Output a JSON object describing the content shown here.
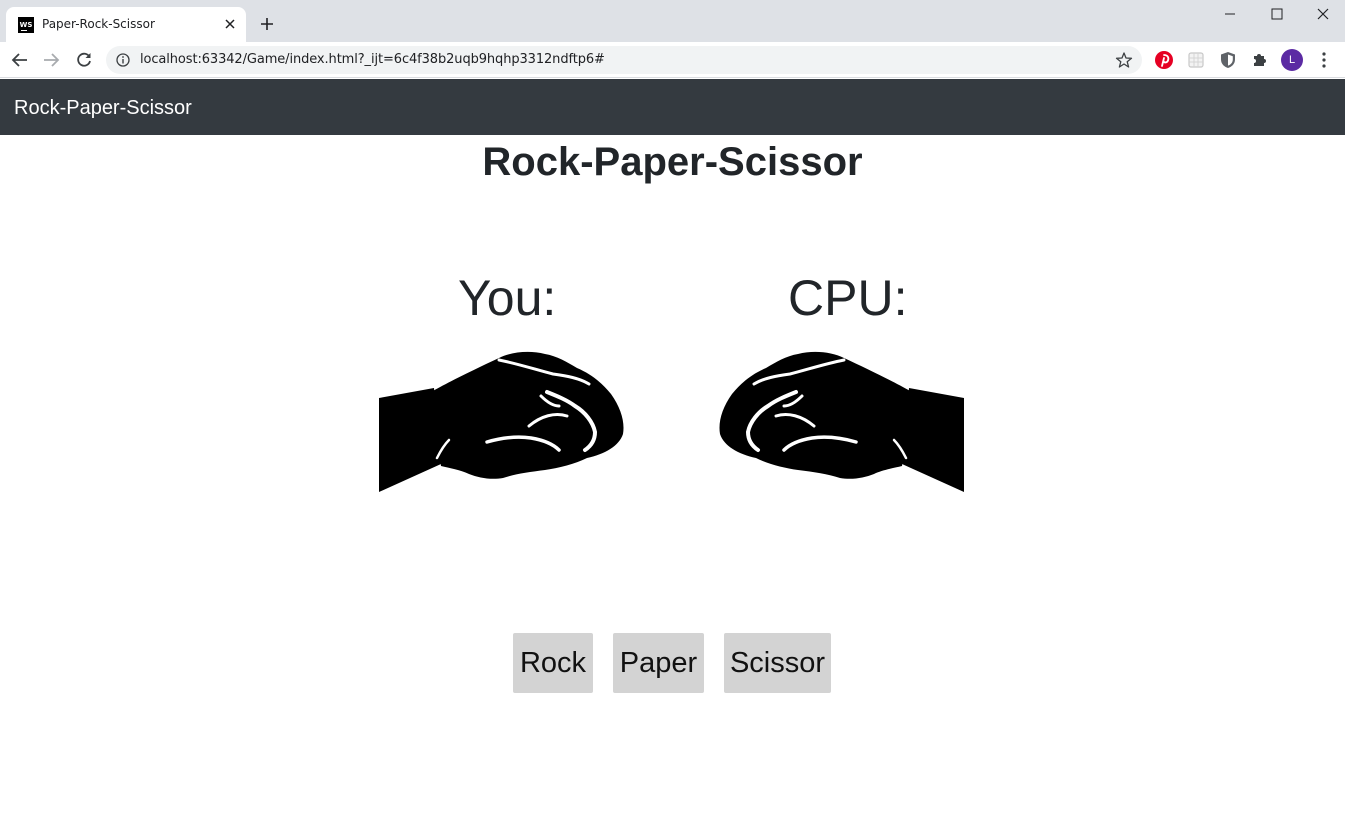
{
  "browser": {
    "tab": {
      "title": "Paper-Rock-Scissor",
      "favicon_text": "WS"
    },
    "url": "localhost:63342/Game/index.html?_ijt=6c4f38b2uqb9hqhp3312ndftp6#",
    "profile_initial": "L"
  },
  "navbar": {
    "brand": "Rock-Paper-Scissor"
  },
  "main": {
    "heading": "Rock-Paper-Scissor",
    "players": {
      "you_label": "You:",
      "cpu_label": "CPU:"
    },
    "you_hand": "rock-fist-icon",
    "cpu_hand": "rock-fist-icon",
    "choices": [
      {
        "label": "Rock"
      },
      {
        "label": "Paper"
      },
      {
        "label": "Scissor"
      }
    ]
  },
  "colors": {
    "navbar_bg": "#343a40",
    "button_bg": "#d3d3d3",
    "text": "#212529",
    "tabstrip_bg": "#dee1e6",
    "omnibox_bg": "#f1f3f4"
  }
}
